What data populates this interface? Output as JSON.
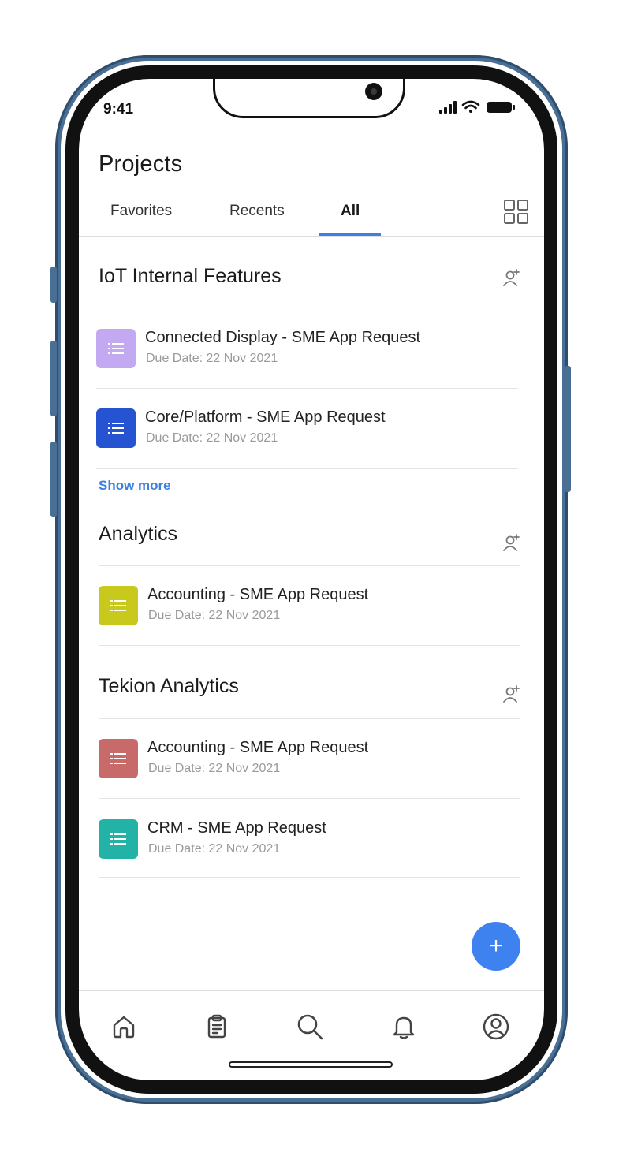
{
  "status_bar": {
    "time": "9:41"
  },
  "header": {
    "title": "Projects"
  },
  "tabs": [
    {
      "label": "Favorites",
      "active": false
    },
    {
      "label": "Recents",
      "active": false
    },
    {
      "label": "All",
      "active": true
    }
  ],
  "sections": [
    {
      "title": "IoT Internal Features",
      "items": [
        {
          "name": "Connected Display - SME App Request",
          "due": "Due Date: 22 Nov 2021",
          "color": "#c3a8f2"
        },
        {
          "name": "Core/Platform - SME App Request",
          "due": "Due Date: 22 Nov 2021",
          "color": "#2653d1"
        }
      ],
      "show_more": "Show more"
    },
    {
      "title": "Analytics",
      "items": [
        {
          "name": "Accounting - SME App Request",
          "due": "Due Date: 22 Nov 2021",
          "color": "#c9c81c"
        }
      ]
    },
    {
      "title": "Tekion Analytics",
      "items": [
        {
          "name": "Accounting - SME App Request",
          "due": "Due Date: 22 Nov 2021",
          "color": "#c86a6a"
        },
        {
          "name": "CRM - SME App Request",
          "due": "Due Date: 22 Nov 2021",
          "color": "#22b2a6"
        }
      ]
    }
  ],
  "fab": {
    "label": "+",
    "color": "#3d82ef"
  },
  "bottom_nav": [
    {
      "name": "home",
      "icon": "home-icon"
    },
    {
      "name": "projects",
      "icon": "clipboard-icon"
    },
    {
      "name": "search",
      "icon": "search-icon"
    },
    {
      "name": "notifications",
      "icon": "bell-icon"
    },
    {
      "name": "profile",
      "icon": "profile-icon"
    }
  ],
  "colors": {
    "accent": "#3d7fe0",
    "frame": "#4a6f94"
  }
}
